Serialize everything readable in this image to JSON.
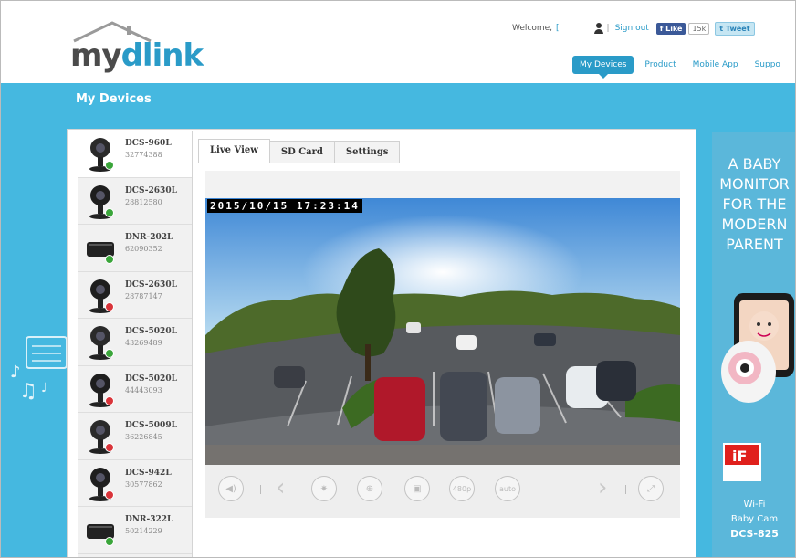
{
  "header": {
    "welcome": "Welcome,",
    "signout": "Sign out",
    "fb_like": "Like",
    "fb_count": "15k",
    "tweet": "Tweet",
    "nav": [
      "My Devices",
      "Product",
      "Mobile App",
      "Suppo"
    ]
  },
  "logo": {
    "my": "my",
    "dlink": "dlink"
  },
  "page_title": "My Devices",
  "devices": [
    {
      "model": "DCS-960L",
      "serial": "32774388",
      "status": "ok",
      "icon": "camera-icon"
    },
    {
      "model": "DCS-2630L",
      "serial": "28812580",
      "status": "ok",
      "icon": "camera-icon"
    },
    {
      "model": "DNR-202L",
      "serial": "62090352",
      "status": "ok",
      "icon": "nvr-icon"
    },
    {
      "model": "DCS-2630L",
      "serial": "28787147",
      "status": "err",
      "icon": "camera-icon"
    },
    {
      "model": "DCS-5020L",
      "serial": "43269489",
      "status": "ok",
      "icon": "camera-icon"
    },
    {
      "model": "DCS-5020L",
      "serial": "44443093",
      "status": "err",
      "icon": "camera-icon"
    },
    {
      "model": "DCS-5009L",
      "serial": "36226845",
      "status": "err",
      "icon": "camera-icon"
    },
    {
      "model": "DCS-942L",
      "serial": "30577862",
      "status": "err",
      "icon": "camera-icon"
    },
    {
      "model": "DNR-322L",
      "serial": "50214229",
      "status": "ok",
      "icon": "nvr-icon"
    }
  ],
  "tabs": [
    "Live View",
    "SD Card",
    "Settings"
  ],
  "timestamp": "2015/10/15 17:23:14",
  "controls": {
    "volume": "volume-icon",
    "prev": "chevron-left-icon",
    "brightness": "sun-icon",
    "zoom": "zoom-icon",
    "snapshot": "snapshot-icon",
    "resolution": "480p",
    "auto": "auto",
    "next": "chevron-right-icon",
    "fullscreen": "fullscreen-icon"
  },
  "ad": {
    "headline": [
      "A BABY",
      "MONITOR",
      "FOR THE",
      "MODERN",
      "PARENT"
    ],
    "award": "iF",
    "foot": [
      "Wi-Fi",
      "Baby Cam"
    ],
    "model": "DCS-825"
  }
}
